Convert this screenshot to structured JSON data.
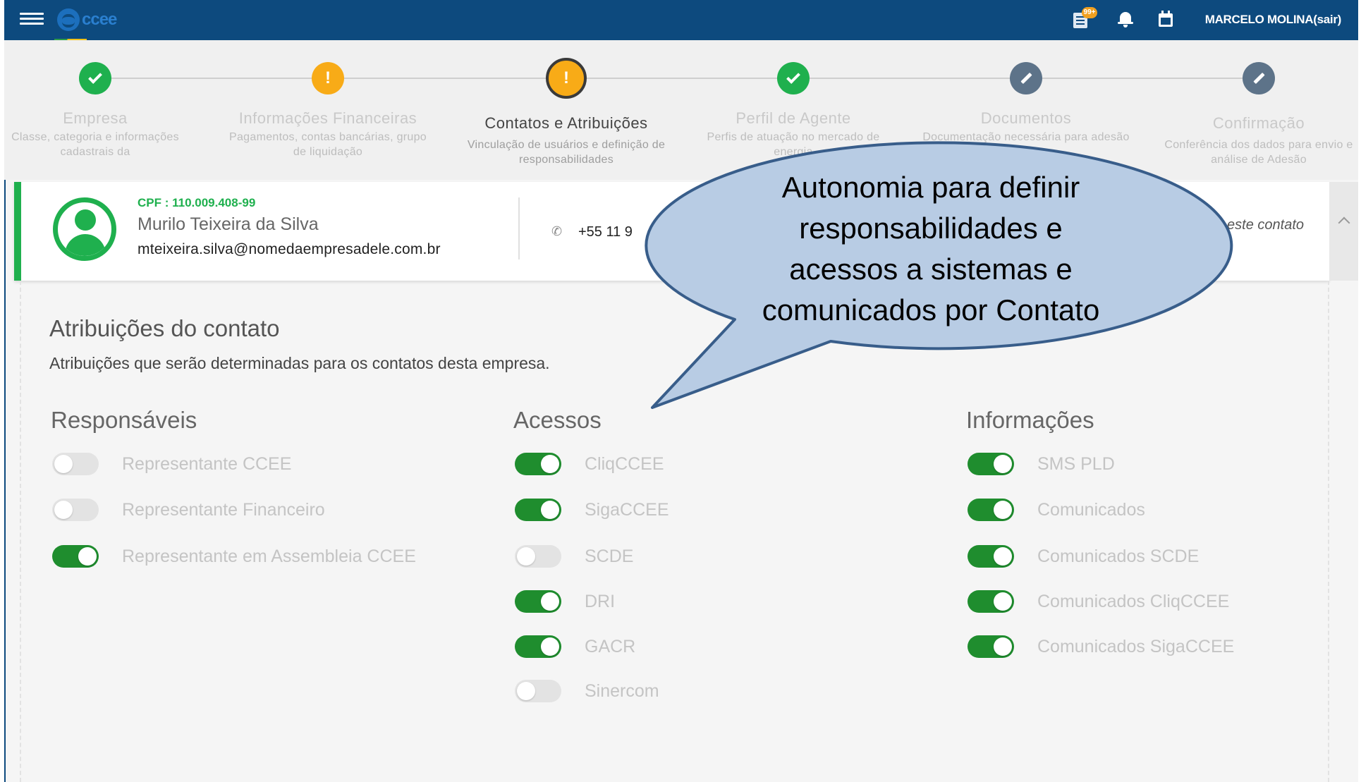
{
  "header": {
    "logo_text": "ccee",
    "tasks_badge": "99+",
    "user_name": "MARCELO MOLINA(sair)"
  },
  "stepper": [
    {
      "title": "Empresa",
      "desc": "Classe, categoria e informações cadastrais da",
      "status": "ok"
    },
    {
      "title": "Informações Financeiras",
      "desc": "Pagamentos, contas bancárias, grupo de liquidação",
      "status": "warn"
    },
    {
      "title": "Contatos e Atribuições",
      "desc": "Vinculação de usuários e definição de responsabilidades",
      "status": "current"
    },
    {
      "title": "Perfil de Agente",
      "desc": "Perfis de atuação no mercado de energia",
      "status": "ok"
    },
    {
      "title": "Documentos",
      "desc": "Documentação necessária para adesão",
      "status": "edit"
    },
    {
      "title": "Confirmação",
      "desc": "Conferência dos dados para envio e análise de Adesão",
      "status": "edit"
    }
  ],
  "contact": {
    "cpf": "CPF : 110.009.408-99",
    "name": "Murilo Teixeira da Silva",
    "email": "mteixeira.silva@nomedaempresadele.com.br",
    "phone": "+55 11 9",
    "edit_link": "este contato"
  },
  "attributions": {
    "title": "Atribuições do contato",
    "description": "Atribuições que serão determinadas para os contatos desta empresa.",
    "columns": [
      {
        "title": "Responsáveis",
        "items": [
          {
            "label": "Representante CCEE",
            "on": false
          },
          {
            "label": "Representante Financeiro",
            "on": false
          },
          {
            "label": "Representante em Assembleia CCEE",
            "on": true
          }
        ]
      },
      {
        "title": "Acessos",
        "items": [
          {
            "label": "CliqCCEE",
            "on": true
          },
          {
            "label": "SigaCCEE",
            "on": true
          },
          {
            "label": "SCDE",
            "on": false
          },
          {
            "label": "DRI",
            "on": true
          },
          {
            "label": "GACR",
            "on": true
          },
          {
            "label": "Sinercom",
            "on": false
          }
        ]
      },
      {
        "title": "Informações",
        "items": [
          {
            "label": "SMS PLD",
            "on": true
          },
          {
            "label": "Comunicados",
            "on": true
          },
          {
            "label": "Comunicados SCDE",
            "on": true
          },
          {
            "label": "Comunicados CliqCCEE",
            "on": true
          },
          {
            "label": "Comunicados SigaCCEE",
            "on": true
          }
        ]
      }
    ]
  },
  "callout": {
    "lines": [
      "Autonomia para definir",
      "responsabilidades e",
      "acessos a sistemas e",
      "comunicados por Contato"
    ],
    "fill": "#b8cce4",
    "stroke": "#385d8a"
  },
  "colors": {
    "header": "#0d4a7e",
    "success": "#1fb04e",
    "warning": "#f8ab17",
    "pending": "#5d7389",
    "toggle_on": "#1f8d2e"
  }
}
